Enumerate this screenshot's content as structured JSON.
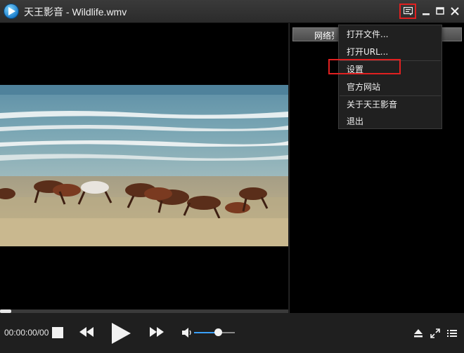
{
  "window": {
    "title": "天王影音 - Wildlife.wmv"
  },
  "playlist": {
    "tab_label": "网络列"
  },
  "menu": {
    "items": [
      {
        "label": "打开文件..."
      },
      {
        "label": "打开URL..."
      },
      {
        "label": "设置"
      },
      {
        "label": "官方网站"
      },
      {
        "label": "关于天王影音"
      },
      {
        "label": "退出"
      }
    ]
  },
  "playback": {
    "time": "00:00:00/00",
    "progress_fraction": 0.04,
    "volume_fraction": 0.58
  },
  "colors": {
    "highlight": "#e02020",
    "accent": "#3aa0ff"
  },
  "icons": [
    "app-logo-icon",
    "menu-icon",
    "minimize-icon",
    "maximize-icon",
    "close-icon",
    "stop-icon",
    "rewind-icon",
    "play-icon",
    "fast-forward-icon",
    "volume-icon",
    "eject-icon",
    "fullscreen-icon",
    "playlist-icon"
  ]
}
